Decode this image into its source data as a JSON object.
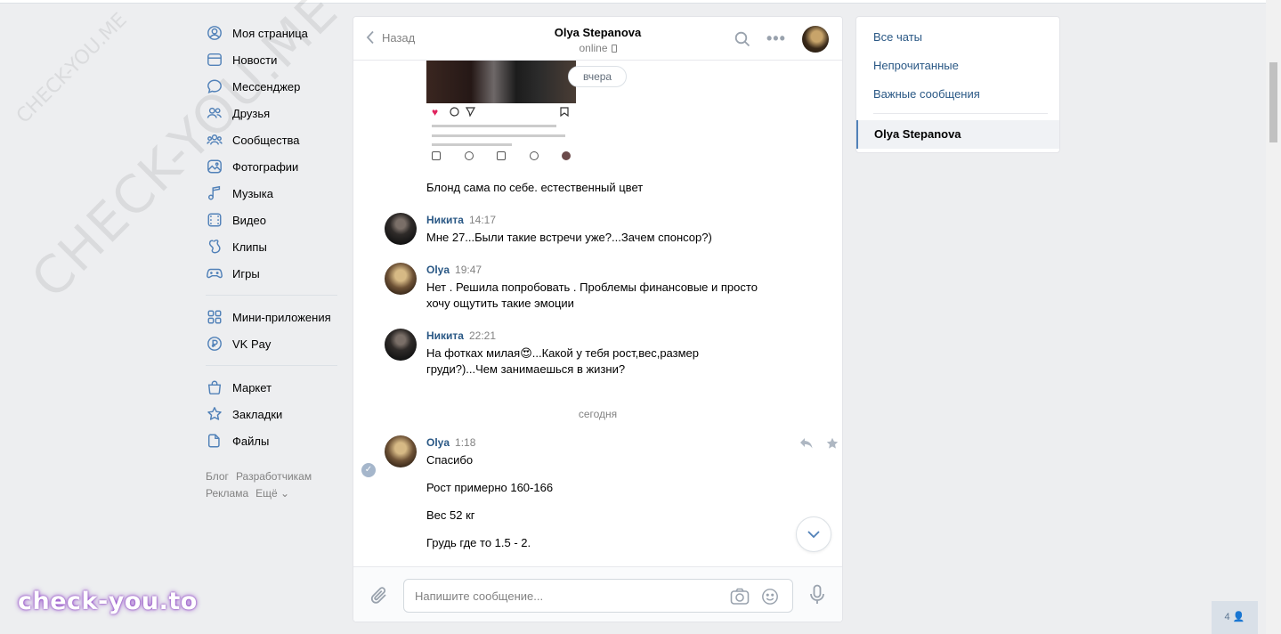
{
  "watermark": {
    "small": "CHECK-YOU.ME",
    "large": "CHECK-YOU.ME",
    "logo": "check-you.to"
  },
  "nav": {
    "items": [
      {
        "label": "Моя страница",
        "icon": "profile-icon"
      },
      {
        "label": "Новости",
        "icon": "news-icon"
      },
      {
        "label": "Мессенджер",
        "icon": "messenger-icon"
      },
      {
        "label": "Друзья",
        "icon": "friends-icon"
      },
      {
        "label": "Сообщества",
        "icon": "communities-icon"
      },
      {
        "label": "Фотографии",
        "icon": "photos-icon"
      },
      {
        "label": "Музыка",
        "icon": "music-icon"
      },
      {
        "label": "Видео",
        "icon": "video-icon"
      },
      {
        "label": "Клипы",
        "icon": "clips-icon"
      },
      {
        "label": "Игры",
        "icon": "games-icon"
      }
    ],
    "items2": [
      {
        "label": "Мини-приложения",
        "icon": "mini-apps-icon"
      },
      {
        "label": "VK Pay",
        "icon": "vkpay-icon"
      }
    ],
    "items3": [
      {
        "label": "Маркет",
        "icon": "market-icon"
      },
      {
        "label": "Закладки",
        "icon": "bookmarks-icon"
      },
      {
        "label": "Файлы",
        "icon": "files-icon"
      }
    ],
    "footer": {
      "blog": "Блог",
      "developers": "Разработчикам",
      "ads": "Реклама",
      "more": "Ещё ⌄"
    }
  },
  "chat": {
    "back_label": "Назад",
    "peer_name": "Olya Stepanova",
    "peer_status": "online",
    "day_yesterday": "вчера",
    "day_today": "сегодня",
    "photo_caption": "Блонд сама по себе. естественный цвет",
    "messages": [
      {
        "author": "Никита",
        "time": "14:17",
        "lines": [
          "Мне 27...Были такие встречи уже?...Зачем спонсор?)"
        ]
      },
      {
        "author": "Olya",
        "time": "19:47",
        "lines": [
          "Нет . Решила попробовать . Проблемы финансовые и просто",
          "хочу ощутить такие эмоции"
        ]
      },
      {
        "author": "Никита",
        "time": "22:21",
        "lines": [
          "На фотках милая😍...Какой у тебя рост,вес,размер",
          "груди?)...Чем занимаешься в жизни?"
        ]
      },
      {
        "author": "Olya",
        "time": "1:18",
        "lines": [
          "Спасибо",
          "Рост примерно 160-166",
          "Вес 52 кг",
          "Грудь где то 1.5 - 2."
        ]
      }
    ],
    "composer": {
      "placeholder": "Напишите сообщение..."
    }
  },
  "right_panel": {
    "all_chats": "Все чаты",
    "unread": "Непрочитанные",
    "important": "Важные сообщения",
    "active_chat": "Olya Stepanova"
  },
  "online_count": "4",
  "colors": {
    "link": "#2a5885",
    "background": "#edeef0",
    "accent": "#5181b8"
  }
}
